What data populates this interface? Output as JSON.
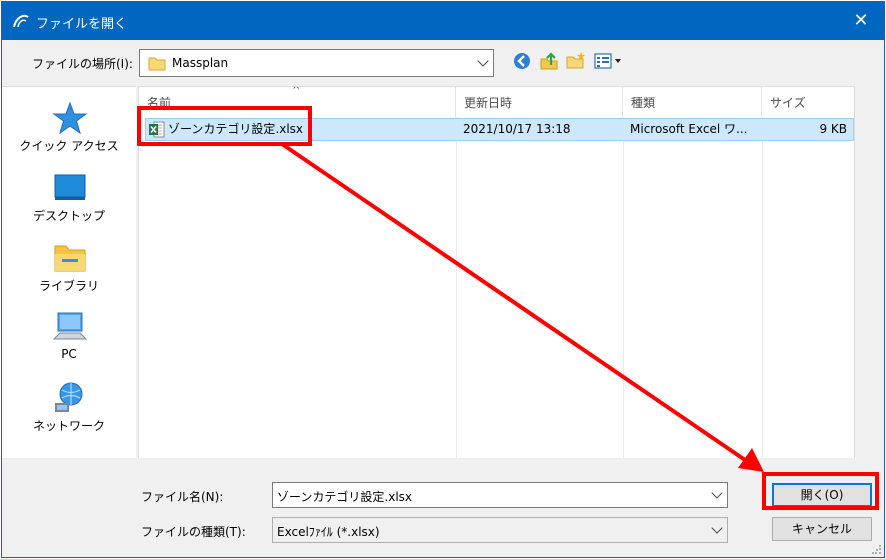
{
  "window": {
    "title": "ファイルを開く",
    "close_glyph": "✕"
  },
  "toolbar": {
    "location_label": "ファイルの場所(I):",
    "location_value": "Massplan",
    "icons": [
      "back-icon",
      "up-folder-icon",
      "new-folder-icon",
      "view-menu-icon"
    ]
  },
  "nav": {
    "items": [
      {
        "label": "クイック アクセス",
        "icon": "star-icon"
      },
      {
        "label": "デスクトップ",
        "icon": "desktop-icon"
      },
      {
        "label": "ライブラリ",
        "icon": "library-folder-icon"
      },
      {
        "label": "PC",
        "icon": "pc-icon"
      },
      {
        "label": "ネットワーク",
        "icon": "network-icon"
      }
    ]
  },
  "filelist": {
    "columns": [
      "名前",
      "更新日時",
      "種類",
      "サイズ"
    ],
    "sort_glyph": "^",
    "files": [
      {
        "name": "ゾーンカテゴリ設定.xlsx",
        "modified": "2021/10/17 13:18",
        "type": "Microsoft Excel ワ...",
        "size": "9 KB",
        "selected": true
      }
    ]
  },
  "bottom": {
    "filename_label": "ファイル名(N):",
    "filename_value": "ゾーンカテゴリ設定.xlsx",
    "filetype_label": "ファイルの種類(T):",
    "filetype_value": "Excelﾌｧｲﾙ (*.xlsx)",
    "open_button": "開く(O)",
    "cancel_button": "キャンセル"
  },
  "colors": {
    "titlebar": "#0067c0",
    "selection": "#cce8ff",
    "annotation": "#ff0000"
  }
}
